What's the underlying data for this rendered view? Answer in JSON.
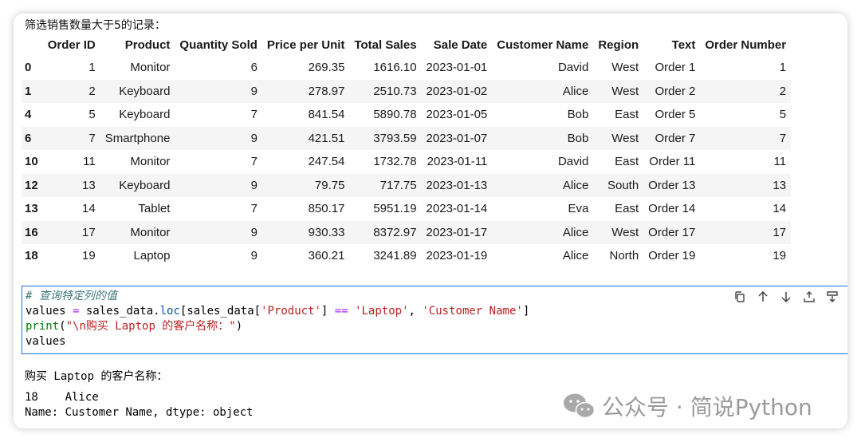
{
  "caption": "筛选销售数量大于5的记录：",
  "table": {
    "columns": [
      "",
      "Order ID",
      "Product",
      "Quantity Sold",
      "Price per Unit",
      "Total Sales",
      "Sale Date",
      "Customer Name",
      "Region",
      "Text",
      "Order Number"
    ],
    "rows": [
      {
        "index": "0",
        "cells": [
          "1",
          "Monitor",
          "6",
          "269.35",
          "1616.10",
          "2023-01-01",
          "David",
          "West",
          "Order 1",
          "1"
        ]
      },
      {
        "index": "1",
        "cells": [
          "2",
          "Keyboard",
          "9",
          "278.97",
          "2510.73",
          "2023-01-02",
          "Alice",
          "West",
          "Order 2",
          "2"
        ]
      },
      {
        "index": "4",
        "cells": [
          "5",
          "Keyboard",
          "7",
          "841.54",
          "5890.78",
          "2023-01-05",
          "Bob",
          "East",
          "Order 5",
          "5"
        ]
      },
      {
        "index": "6",
        "cells": [
          "7",
          "Smartphone",
          "9",
          "421.51",
          "3793.59",
          "2023-01-07",
          "Bob",
          "West",
          "Order 7",
          "7"
        ]
      },
      {
        "index": "10",
        "cells": [
          "11",
          "Monitor",
          "7",
          "247.54",
          "1732.78",
          "2023-01-11",
          "David",
          "East",
          "Order 11",
          "11"
        ]
      },
      {
        "index": "12",
        "cells": [
          "13",
          "Keyboard",
          "9",
          "79.75",
          "717.75",
          "2023-01-13",
          "Alice",
          "South",
          "Order 13",
          "13"
        ]
      },
      {
        "index": "13",
        "cells": [
          "14",
          "Tablet",
          "7",
          "850.17",
          "5951.19",
          "2023-01-14",
          "Eva",
          "East",
          "Order 14",
          "14"
        ]
      },
      {
        "index": "16",
        "cells": [
          "17",
          "Monitor",
          "9",
          "930.33",
          "8372.97",
          "2023-01-17",
          "Alice",
          "West",
          "Order 17",
          "17"
        ]
      },
      {
        "index": "18",
        "cells": [
          "19",
          "Laptop",
          "9",
          "360.21",
          "3241.89",
          "2023-01-19",
          "Alice",
          "North",
          "Order 19",
          "19"
        ]
      }
    ]
  },
  "code_cell": {
    "comment": "# 查询特定列的值",
    "line2": {
      "a": "values ",
      "op1": "=",
      "b": " sales_data.",
      "attr": "loc",
      "c": "[sales_data[",
      "s1": "'Product'",
      "d": "] ",
      "op2": "==",
      "e": " ",
      "s2": "'Laptop'",
      "f": ", ",
      "s3": "'Customer Name'",
      "g": "]"
    },
    "line3": {
      "fn": "print",
      "a": "(",
      "s": "\"\\n购买 Laptop 的客户名称：\"",
      "b": ")"
    },
    "line4": "values"
  },
  "toolbar": {
    "icons": [
      "copy-icon",
      "arrow-up-icon",
      "arrow-down-icon",
      "insert-above-icon",
      "insert-below-icon"
    ]
  },
  "output": {
    "line1": "购买 Laptop 的客户名称：",
    "line2": "18    Alice",
    "line3": "Name: Customer Name, dtype: object"
  },
  "watermark": {
    "text": "公众号 · 简说Python",
    "color": "#9b9b9b"
  },
  "colors": {
    "cell_border": "#1e6fd9",
    "string": "#ba2121",
    "operator": "#aa22ff",
    "builtin": "#008000",
    "comment": "#3f7a7a"
  }
}
